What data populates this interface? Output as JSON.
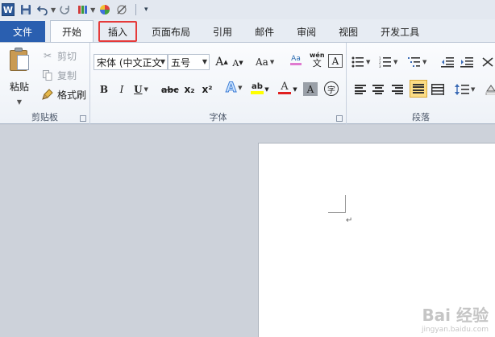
{
  "app": {
    "logo": "W"
  },
  "quick_access": {
    "save_icon": "save-icon",
    "undo_icon": "undo-icon",
    "redo_icon": "redo-icon"
  },
  "tabs": [
    {
      "label": "文件"
    },
    {
      "label": "开始"
    },
    {
      "label": "插入"
    },
    {
      "label": "页面布局"
    },
    {
      "label": "引用"
    },
    {
      "label": "邮件"
    },
    {
      "label": "审阅"
    },
    {
      "label": "视图"
    },
    {
      "label": "开发工具"
    }
  ],
  "clipboard": {
    "paste_label": "粘贴",
    "cut_label": "剪切",
    "copy_label": "复制",
    "format_painter_label": "格式刷",
    "group_label": "剪贴板"
  },
  "font": {
    "font_name": "宋体 (中文正文",
    "font_size": "五号",
    "group_label": "字体",
    "grow_label": "A",
    "shrink_label": "A",
    "case_label": "Aa",
    "bold": "B",
    "italic": "I",
    "underline": "U",
    "strike": "abc",
    "subscript": "x₂",
    "superscript": "x²",
    "effects": "A",
    "highlight": "ab",
    "font_color": "A",
    "char_shade": "A",
    "enclose": "字",
    "phonetic_top": "wén",
    "phonetic_char": "文",
    "char_border": "A",
    "clear_top": "Aa"
  },
  "paragraph": {
    "group_label": "段落"
  },
  "colors": {
    "file_tab": "#2a5fb0",
    "highlight_border": "#e53a3a",
    "active_align": "#fbdc85",
    "font_color_bar": "#e02020",
    "highlight_bar": "#ffff00"
  },
  "watermark": {
    "brand": "Bai 经验",
    "url": "jingyan.baidu.com"
  },
  "document": {
    "paragraph_mark": "↵"
  }
}
